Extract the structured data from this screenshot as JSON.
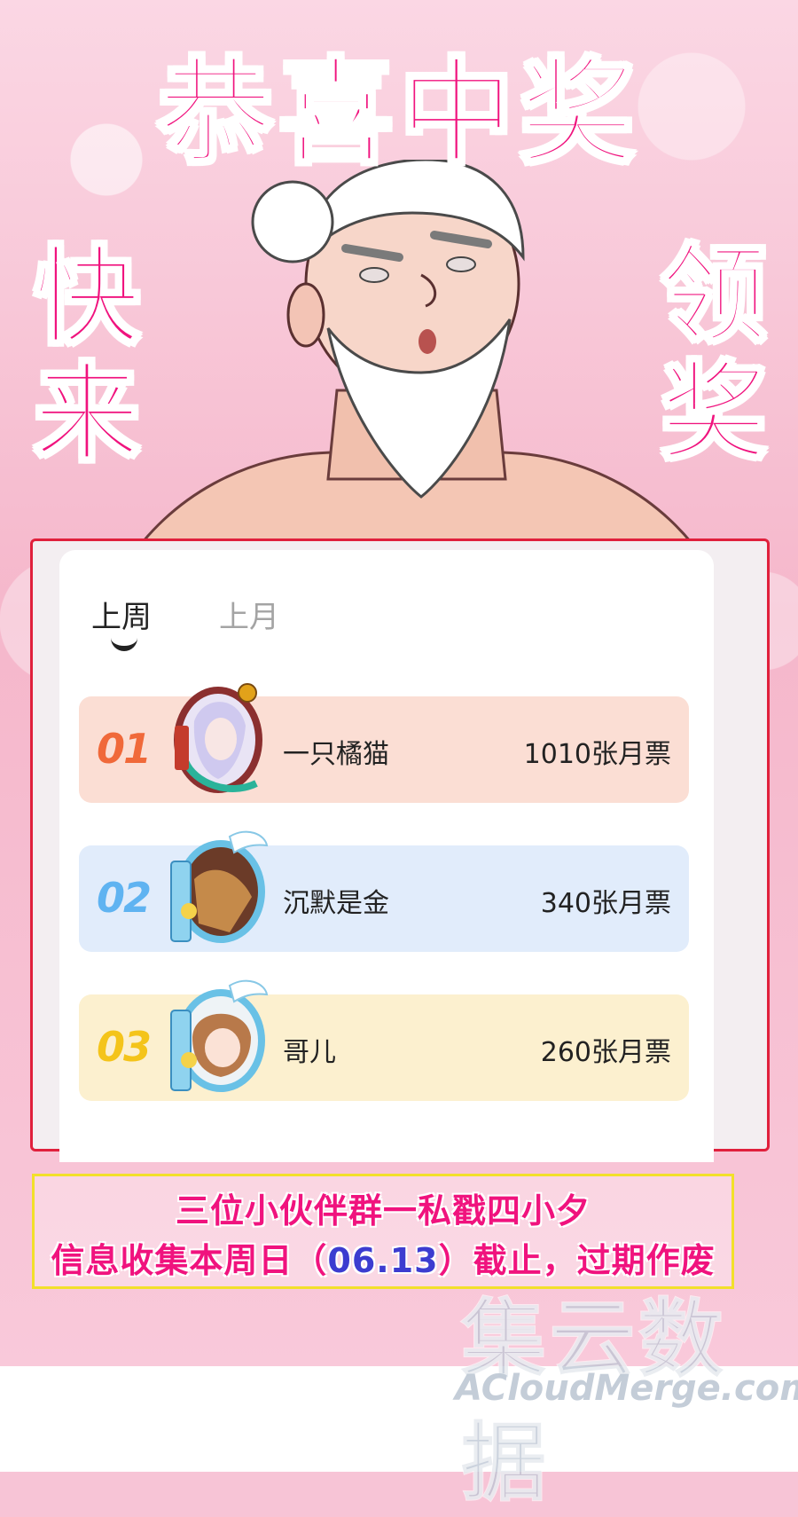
{
  "banner": {
    "title": "恭喜中奖",
    "left_vertical": "快来",
    "right_vertical": "领奖"
  },
  "ranking": {
    "tabs": [
      {
        "label": "上周",
        "active": true
      },
      {
        "label": "上月",
        "active": false
      }
    ],
    "entries": [
      {
        "rank": "01",
        "name": "一只橘猫",
        "votes": "1010张月票",
        "rank_color": "#f0693a"
      },
      {
        "rank": "02",
        "name": "沉默是金",
        "votes": "340张月票",
        "rank_color": "#5fb3f1"
      },
      {
        "rank": "03",
        "name": "哥儿",
        "votes": "260张月票",
        "rank_color": "#f4c41a"
      }
    ]
  },
  "notice": {
    "line1": "三位小伙伴群一私戳四小夕",
    "line2_pre": "信息收集本周日（",
    "line2_date": "06.13",
    "line2_post": "）截止，过期作废"
  },
  "watermark": {
    "cn": "集云数据",
    "en": "ACloudMerge.com"
  },
  "colors": {
    "accent": "#f0137e",
    "panel_border": "#e0203c",
    "notice_border": "#f2e02a"
  }
}
